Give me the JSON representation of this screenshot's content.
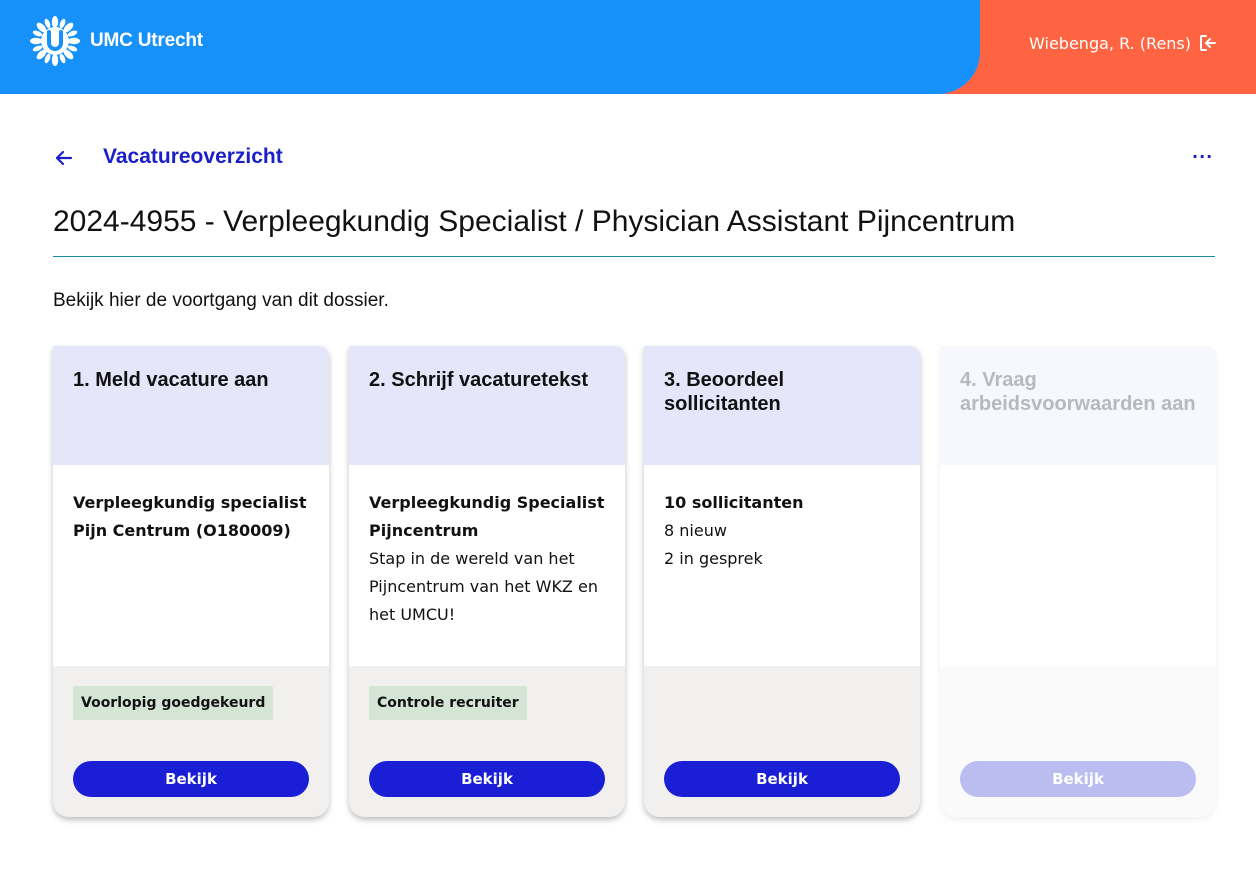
{
  "header": {
    "logo_text": "UMC Utrecht",
    "user_name": "Wiebenga, R. (Rens)",
    "logout_icon": "logout-icon",
    "colors": {
      "primary": "#1691fa",
      "accent": "#ff6442"
    }
  },
  "nav": {
    "back_icon": "arrow-left-icon",
    "back_label": "Vacatureoverzicht",
    "more_label": "···"
  },
  "page": {
    "title": "2024-4955 - Verpleegkundig Specialist / Physician Assistant Pijncentrum",
    "intro": "Bekijk hier de voortgang van dit dossier."
  },
  "steps": [
    {
      "title": "1. Meld vacature aan",
      "body_strong": "Verpleegkundig specialist Pijn Centrum (O180009)",
      "body_lines": [],
      "badge": "Voorlopig goedgekeurd",
      "button": "Bekijk",
      "enabled": true
    },
    {
      "title": "2. Schrijf vacaturetekst",
      "body_strong": "Verpleegkundig Specialist Pijncentrum",
      "body_lines": [
        "Stap in de wereld van het Pijncentrum van het WKZ en het UMCU!"
      ],
      "badge": "Controle recruiter",
      "button": "Bekijk",
      "enabled": true
    },
    {
      "title": "3. Beoordeel sollicitanten",
      "body_strong": "10 sollicitanten",
      "body_lines": [
        "8 nieuw",
        "2 in gesprek"
      ],
      "badge": "",
      "button": "Bekijk",
      "enabled": true
    },
    {
      "title": "4. Vraag arbeidsvoorwaarden aan",
      "body_strong": "",
      "body_lines": [],
      "badge": "",
      "button": "Bekijk",
      "enabled": false
    }
  ]
}
